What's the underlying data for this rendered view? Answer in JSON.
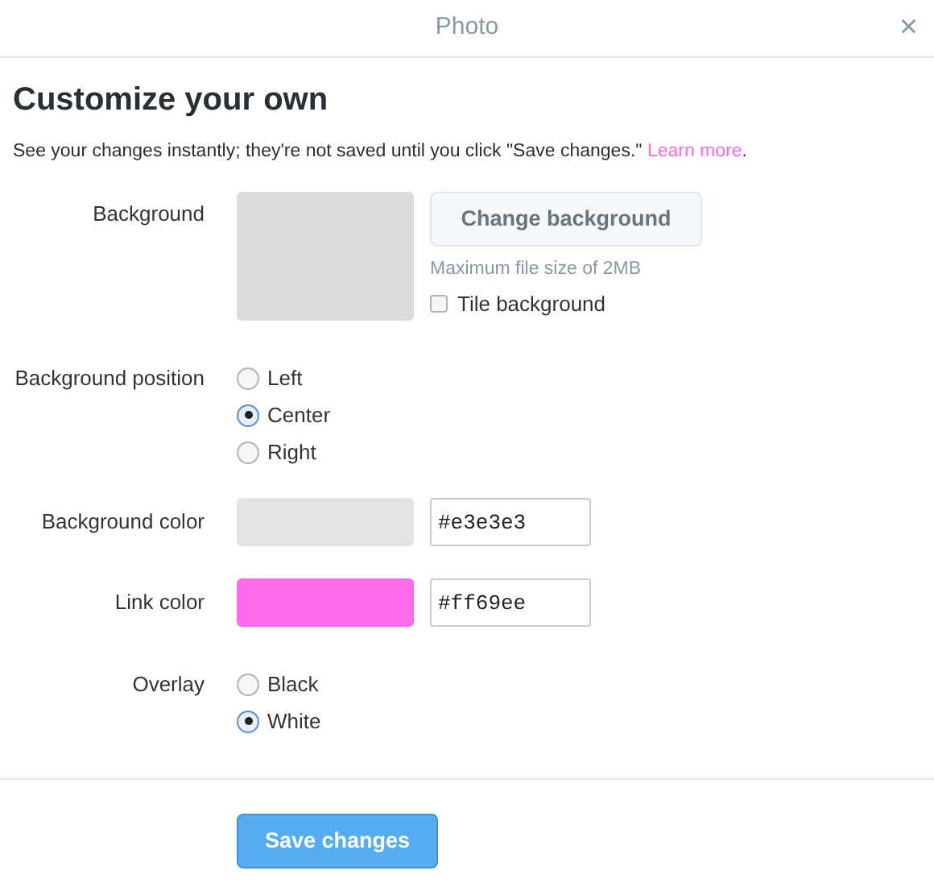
{
  "window": {
    "title": "Photo",
    "close": "×"
  },
  "heading": "Customize your own",
  "description": {
    "text": "See your changes instantly; they're not saved until you click \"Save changes.\"",
    "link": "Learn more",
    "end": "."
  },
  "background": {
    "label": "Background",
    "button": "Change background",
    "hint": "Maximum file size of 2MB",
    "tile": {
      "label": "Tile background",
      "checked": false
    }
  },
  "position": {
    "label": "Background position",
    "options": [
      {
        "label": "Left",
        "selected": false
      },
      {
        "label": "Center",
        "selected": true
      },
      {
        "label": "Right",
        "selected": false
      }
    ]
  },
  "colors": [
    {
      "label": "Background color",
      "value": "#e3e3e3",
      "color": "#e3e3e3"
    },
    {
      "label": "Link color",
      "value": "#ff69ee",
      "color": "#ff69ee"
    }
  ],
  "overlay": {
    "label": "Overlay",
    "options": [
      {
        "label": "Black",
        "selected": false
      },
      {
        "label": "White",
        "selected": true
      }
    ]
  },
  "save_button": "Save changes"
}
